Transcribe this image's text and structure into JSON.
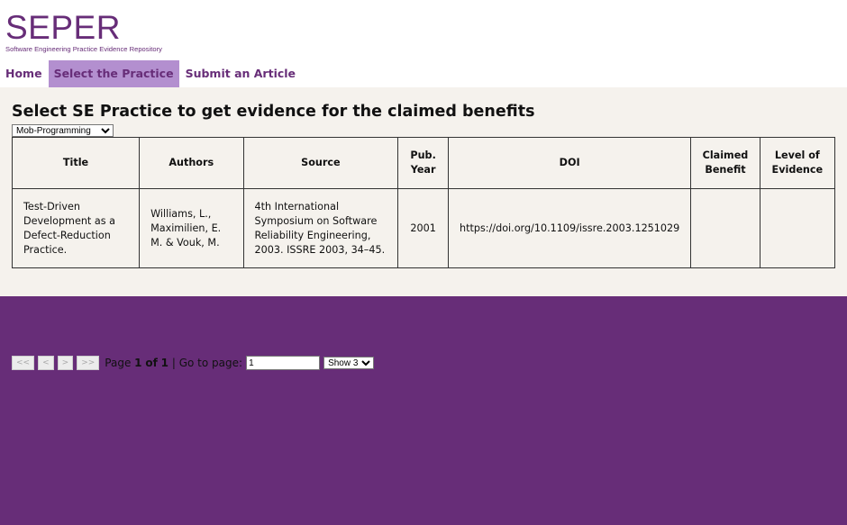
{
  "brand": {
    "title": "SEPER",
    "subtitle": "Software Engineering Practice Evidence Repository",
    "color": "#672d78"
  },
  "nav": {
    "items": [
      {
        "label": "Home"
      },
      {
        "label": "Select the Practice",
        "active": true
      },
      {
        "label": "Submit an Article"
      }
    ]
  },
  "main": {
    "title": "Select SE Practice to get evidence for the claimed benefits",
    "practice_select": {
      "selected": "Mob-Programming"
    }
  },
  "table": {
    "headers": {
      "title": "Title",
      "authors": "Authors",
      "source": "Source",
      "pub_year": "Pub. Year",
      "doi": "DOI",
      "claimed_benefit": "Claimed Benefit",
      "level_of_evidence": "Level of Evidence"
    },
    "rows": [
      {
        "title": "Test-Driven Development as a Defect-Reduction Practice.",
        "authors": "Williams, L., Maximilien, E. M. & Vouk, M.",
        "source": "4th International Symposium on Software Reliability Engineering, 2003. ISSRE 2003, 34–45.",
        "pub_year": "2001",
        "doi": "https://doi.org/10.1109/issre.2003.1251029",
        "claimed_benefit": "",
        "level_of_evidence": ""
      }
    ]
  },
  "pager": {
    "first": "<<",
    "prev": "<",
    "next": ">",
    "last": ">>",
    "page_prefix": "Page",
    "current_page": "1",
    "of_word": "of",
    "total_pages": "1",
    "separator": "|",
    "goto_label": "Go to page:",
    "goto_value": "1",
    "show_selected": "Show 3"
  },
  "colors": {
    "accent": "#672d78",
    "nav_active": "#b38fcf",
    "content_bg": "#f5f2ed"
  }
}
